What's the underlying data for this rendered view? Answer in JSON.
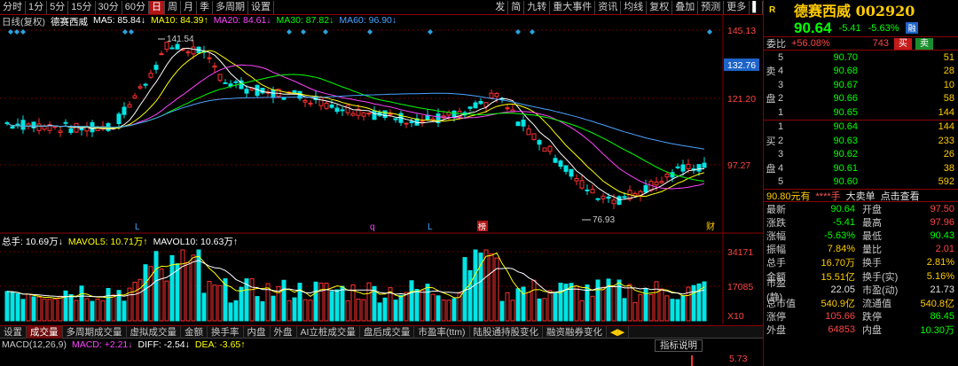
{
  "toolbar": {
    "periods": [
      "分时",
      "1分",
      "5分",
      "15分",
      "30分",
      "60分",
      "日",
      "周",
      "月",
      "季",
      "多周期",
      "设置"
    ],
    "active_period": "日",
    "right_tools": [
      "发",
      "简",
      "九转",
      "重大事件",
      "资讯",
      "均线",
      "复权",
      "叠加",
      "预测",
      "更多"
    ]
  },
  "price_info": {
    "label": "日线(复权)",
    "name": "德赛西威",
    "ma5": "MA5: 85.84↓",
    "ma10": "MA10: 84.39↑",
    "ma20": "MA20: 84.61↓",
    "ma30": "MA30: 87.82↓",
    "ma60": "MA60: 96.90↓"
  },
  "price_axis": {
    "labels": [
      "145.13",
      "132.76",
      "121.20",
      "97.27"
    ],
    "current": "132.76"
  },
  "annotations": {
    "high": "141.54",
    "low": "76.93"
  },
  "markers": [
    "L",
    "q",
    "L",
    "榜",
    "财"
  ],
  "volume_info": {
    "total": "总手: 10.69万↓",
    "mavol5": "MAVOL5: 10.71万↑",
    "mavol10": "MAVOL10: 10.63万↑"
  },
  "volume_axis": {
    "labels": [
      "34171",
      "17085",
      "X10"
    ]
  },
  "tabs": [
    "设置",
    "成交量",
    "多周期成交量",
    "虚拟成交量",
    "金额",
    "换手率",
    "内盘",
    "外盘",
    "AI立桩成交量",
    "盘后成交量",
    "市盈率(ttm)",
    "陆股通持股变化",
    "融资融券变化"
  ],
  "active_tab": "成交量",
  "macd_info": {
    "label": "MACD(12,26,9)",
    "macd": "MACD: +2.21↓",
    "diff": "DIFF: -2.54↓",
    "dea": "DEA: -3.65↑"
  },
  "macd_button": "指标说明",
  "macd_axis": "5.73",
  "stock": {
    "badge": "R",
    "name": "德赛西威 002920",
    "price": "90.64",
    "change": "-5.41",
    "change_pct": "-5.63%",
    "rong": "融"
  },
  "weibi": {
    "label": "委比",
    "pct": "+56.08%",
    "diff": "743",
    "buy": "买",
    "sell": "卖"
  },
  "sell_levels": [
    {
      "lvl": "5",
      "price": "90.70",
      "vol": "51"
    },
    {
      "lvl": "4",
      "price": "90.68",
      "vol": "28"
    },
    {
      "lvl": "3",
      "price": "90.67",
      "vol": "10"
    },
    {
      "lvl": "2",
      "price": "90.66",
      "vol": "58"
    },
    {
      "lvl": "1",
      "price": "90.65",
      "vol": "144"
    }
  ],
  "buy_levels": [
    {
      "lvl": "1",
      "price": "90.64",
      "vol": "144"
    },
    {
      "lvl": "2",
      "price": "90.63",
      "vol": "233"
    },
    {
      "lvl": "3",
      "price": "90.62",
      "vol": "26"
    },
    {
      "lvl": "4",
      "price": "90.61",
      "vol": "38"
    },
    {
      "lvl": "5",
      "price": "90.60",
      "vol": "592"
    }
  ],
  "sell_side_chars": [
    "卖",
    "盘"
  ],
  "buy_side_chars": [
    "买",
    "盘"
  ],
  "quote_strip": {
    "a": "90.80元有",
    "b": "****手",
    "c": "大卖单",
    "d": "点击查看"
  },
  "stats": [
    {
      "l1": "最新",
      "v1": "90.64",
      "c1": "green",
      "l2": "开盘",
      "v2": "97.50",
      "c2": "red"
    },
    {
      "l1": "涨跌",
      "v1": "-5.41",
      "c1": "green",
      "l2": "最高",
      "v2": "97.96",
      "c2": "red"
    },
    {
      "l1": "涨幅",
      "v1": "-5.63%",
      "c1": "green",
      "l2": "最低",
      "v2": "90.43",
      "c2": "green"
    },
    {
      "l1": "振幅",
      "v1": "7.84%",
      "c1": "yellow",
      "l2": "量比",
      "v2": "2.01",
      "c2": "red"
    },
    {
      "l1": "总手",
      "v1": "16.70万",
      "c1": "yellow",
      "l2": "换手",
      "v2": "2.81%",
      "c2": "yellow"
    },
    {
      "l1": "金额",
      "v1": "15.51亿",
      "c1": "yellow",
      "l2": "换手(实)",
      "v2": "5.16%",
      "c2": "yellow"
    },
    {
      "l1": "市盈(静)",
      "v1": "22.05",
      "c1": "white",
      "l2": "市盈(动)",
      "v2": "21.73",
      "c2": "white"
    },
    {
      "l1": "总市值",
      "v1": "540.9亿",
      "c1": "yellow",
      "l2": "流通值",
      "v2": "540.8亿",
      "c2": "yellow"
    },
    {
      "l1": "涨停",
      "v1": "105.66",
      "c1": "red",
      "l2": "跌停",
      "v2": "86.45",
      "c2": "green"
    },
    {
      "l1": "外盘",
      "v1": "64853",
      "c1": "red",
      "l2": "内盘",
      "v2": "10.30万",
      "c2": "green"
    }
  ],
  "colors": {
    "up": "#ff3030",
    "down": "#00e5e5",
    "ma5": "#ffffff",
    "ma10": "#ffff00",
    "ma20": "#ff44ff",
    "ma30": "#00ff00",
    "ma60": "#4aa3ff"
  }
}
